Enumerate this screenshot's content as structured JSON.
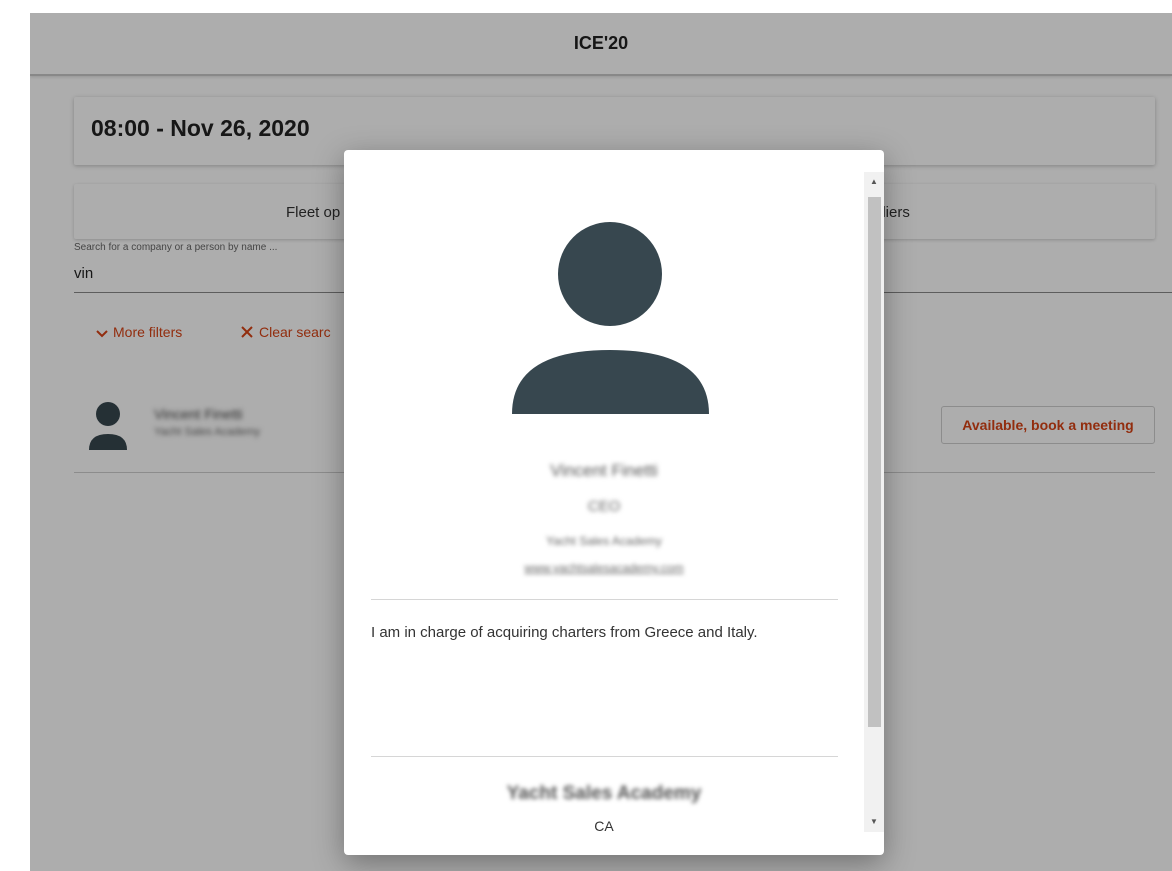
{
  "header": {
    "title": "ICE'20"
  },
  "session": {
    "datetime": "08:00 - Nov 26, 2020"
  },
  "tabs": [
    {
      "label": "Fleet op"
    },
    {
      "label": "pliers"
    }
  ],
  "search": {
    "label": "Search for a company or a person by name ...",
    "value": "vin"
  },
  "filters": {
    "more_label": "More filters",
    "clear_label": "Clear searc"
  },
  "results": [
    {
      "name": "Vincent Finetti",
      "company": "Yacht Sales Academy",
      "action_label": "Available, book a meeting"
    }
  ],
  "profile": {
    "name": "Vincent Finetti",
    "role": "CEO",
    "company": "Yacht Sales Academy",
    "website": "www.yachtsalesacademy.com",
    "bio": "I am in charge of acquiring charters from Greece and Italy.",
    "company_section": {
      "name": "Yacht Sales Academy",
      "country": "CA"
    }
  },
  "colors": {
    "accent": "#d84315",
    "avatar": "#37474f",
    "backdrop": "rgba(0,0,0,0.32)"
  },
  "icons": {
    "more_filters": "chevron-down-icon",
    "clear_search": "close-icon",
    "avatar": "person-icon"
  }
}
